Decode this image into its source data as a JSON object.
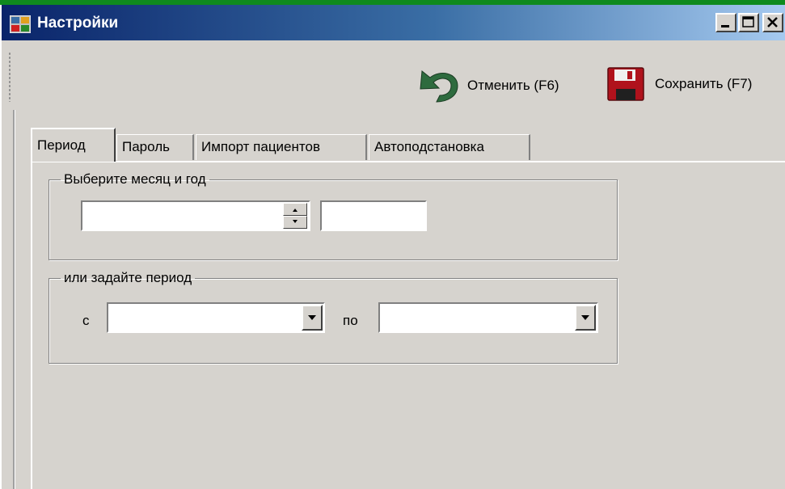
{
  "window": {
    "title": "Настройки",
    "controls": [
      "minimize-icon",
      "maximize-icon",
      "close-icon"
    ]
  },
  "toolbar": {
    "cancel_label": "Отменить (F6)",
    "save_label": "Сохранить (F7)",
    "cancel_icon": "undo-arrow-icon",
    "save_icon": "floppy-disk-icon"
  },
  "tabs": [
    {
      "label": "Период",
      "active": true
    },
    {
      "label": "Пароль",
      "active": false
    },
    {
      "label": "Импорт пациентов",
      "active": false
    },
    {
      "label": "Автоподстановка",
      "active": false
    }
  ],
  "month_group": {
    "legend": "Выберите месяц и год",
    "month_value": "",
    "year_value": ""
  },
  "period_group": {
    "legend": "или задайте период",
    "from_label": "с",
    "from_value": "",
    "to_label": "по",
    "to_value": ""
  },
  "colors": {
    "desktop": "#0f8a1e",
    "titlebar_start": "#0a246a",
    "titlebar_end": "#a6caf0",
    "face": "#d6d3ce",
    "undo_icon": "#2e6b3e",
    "save_icon": "#b0121c"
  }
}
